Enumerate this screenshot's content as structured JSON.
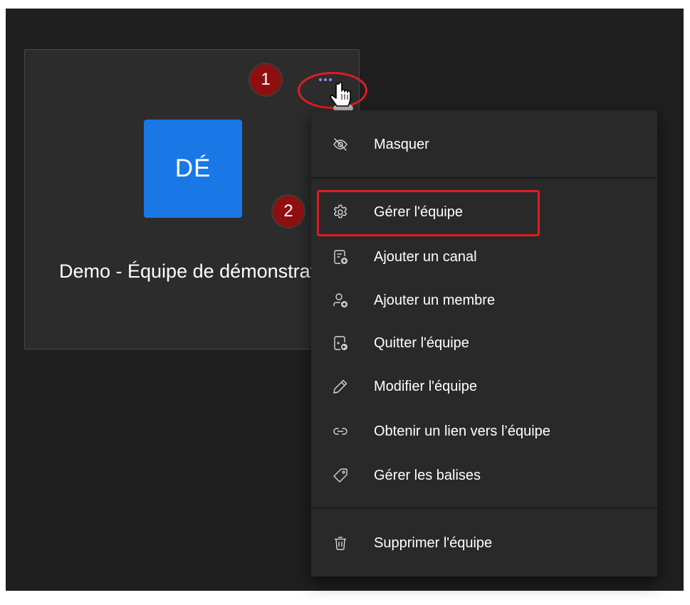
{
  "team_card": {
    "avatar_initials": "DÉ",
    "name": "Demo - Équipe de démonstration"
  },
  "colors": {
    "background": "#1f1f1f",
    "card": "#2d2c2c",
    "avatar": "#1a77e6",
    "menu": "#292929",
    "highlight": "#e11b24",
    "step_badge": "#8e0f0f"
  },
  "annotations": {
    "step1": "1",
    "step2": "2"
  },
  "menu": {
    "items": [
      {
        "label": "Masquer",
        "icon": "eye-off-icon"
      },
      {
        "label": "Gérer l'équipe",
        "icon": "gear-icon"
      },
      {
        "label": "Ajouter un canal",
        "icon": "add-channel-icon"
      },
      {
        "label": "Ajouter un membre",
        "icon": "add-person-icon"
      },
      {
        "label": "Quitter l'équipe",
        "icon": "leave-team-icon"
      },
      {
        "label": "Modifier l'équipe",
        "icon": "pencil-icon"
      },
      {
        "label": "Obtenir un lien vers l’équipe",
        "icon": "link-icon"
      },
      {
        "label": "Gérer les balises",
        "icon": "tag-icon"
      },
      {
        "label": "Supprimer l'équipe",
        "icon": "trash-icon"
      }
    ]
  }
}
